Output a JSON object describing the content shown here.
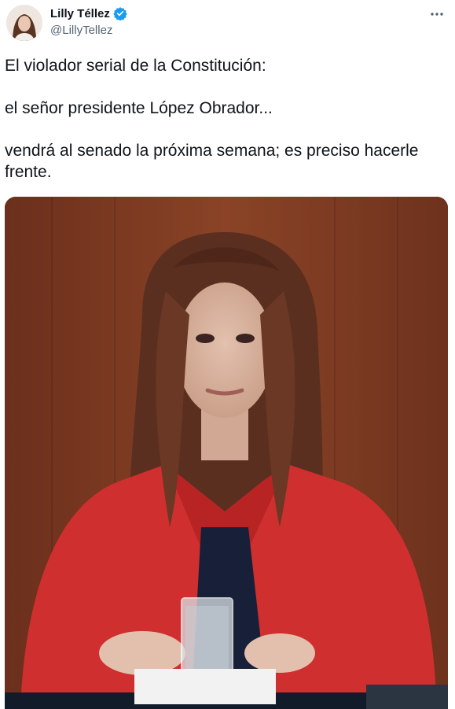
{
  "author": {
    "name": "Lilly Téllez",
    "handle": "@LillyTellez",
    "verified": true
  },
  "tweet": {
    "lines": [
      "El violador serial de la Constitución:",
      "el señor presidente López Obrador...",
      "vendrá al senado la próxima semana; es preciso hacerle frente."
    ]
  },
  "icons": {
    "verified": "verified-badge-icon",
    "more": "more-options-icon"
  },
  "colors": {
    "text": "#0f1419",
    "secondary": "#536471",
    "verified_blue": "#1d9bf0"
  }
}
